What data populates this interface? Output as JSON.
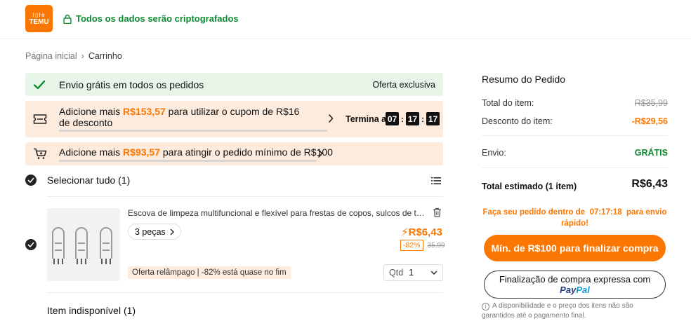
{
  "header": {
    "logo_glyphs": "ŀ▯ŀɘ",
    "logo_text": "TEMU",
    "secure_text": "Todos os dados serão criptografados",
    "accent_color": "#fb7701",
    "secure_color": "#0a8a2f"
  },
  "breadcrumb": {
    "home": "Página inicial",
    "separator": "›",
    "current": "Carrinho"
  },
  "banners": {
    "free_shipping": {
      "text": "Envio grátis em todos os pedidos",
      "badge": "Oferta exclusiva",
      "icon": "check-icon"
    },
    "coupon": {
      "prefix": "Adicione mais",
      "amount": "R$153,57",
      "suffix": "para utilizar o cupom de R$16 de desconto",
      "progress": 0.0,
      "ends_label": "Termina a",
      "timer": [
        "07",
        "17",
        "17"
      ],
      "icon": "ticket-icon"
    },
    "minimum": {
      "prefix": "Adicione mais",
      "amount": "R$93,57",
      "suffix": "para atingir o pedido mínimo de R$100",
      "progress": 0.0,
      "icon": "cart-icon"
    }
  },
  "cart": {
    "select_all": "Selecionar tudo (1)",
    "items": [
      {
        "title": "Escova de limpeza multifuncional e flexível para frestas de copos, sulcos de tampa...",
        "variant": "3 peças",
        "price": "R$6,43",
        "discount": "-82%",
        "old_price": "35,99",
        "flash_text": "Oferta relâmpago | -82% está quase no fim",
        "qty_label": "Qtd",
        "qty_value": "1"
      }
    ],
    "unavailable": "Item indisponível (1)"
  },
  "summary": {
    "title": "Resumo do Pedido",
    "items_total_label": "Total do item:",
    "items_total_value": "R$35,99",
    "item_discount_label": "Desconto do item:",
    "item_discount_value": "-R$29,56",
    "shipping_label": "Envio:",
    "shipping_value": "GRÁTIS",
    "estimated_label": "Total estimado (1 item)",
    "estimated_value": "R$6,43",
    "hurry_prefix": "Faça seu pedido dentro de",
    "hurry_time": "07:17:18",
    "hurry_suffix": "para envio rápido!",
    "checkout_button": "Mín. de R$100 para finalizar compra",
    "express_line": "Finalização de compra expressa com",
    "paypal_a": "Pay",
    "paypal_b": "Pal",
    "disclaimer": "A disponibilidade e o preço dos itens não são garantidos até o pagamento final."
  }
}
